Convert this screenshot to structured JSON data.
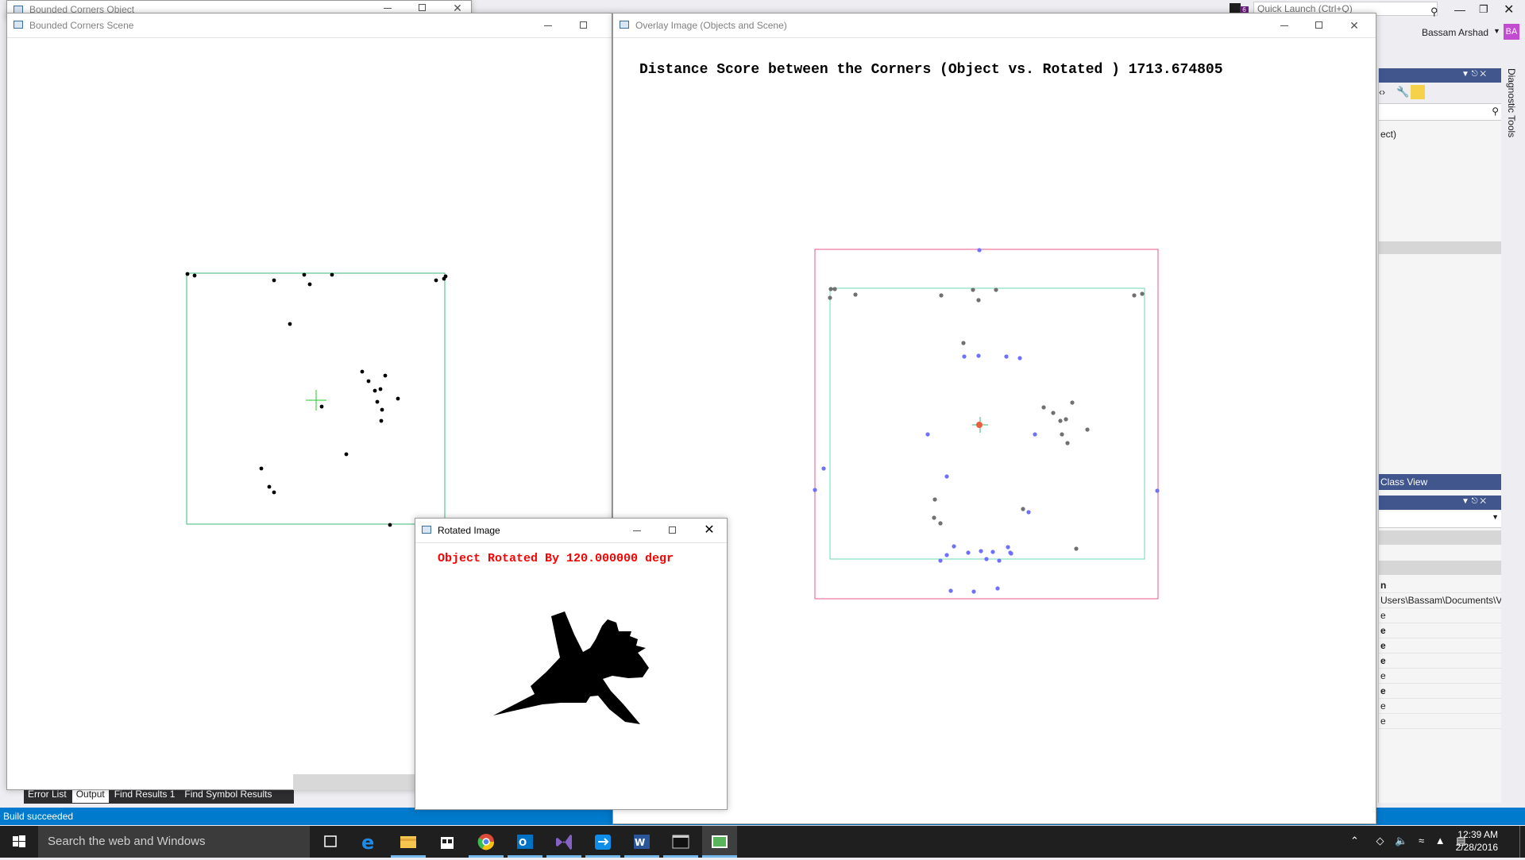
{
  "vs": {
    "quick_launch_placeholder": "Quick Launch (Ctrl+Q)",
    "user_name": "Bassam Arshad",
    "user_initials": "BA",
    "notification_count": "6",
    "diagnostic_tools_label": "Diagnostic Tools",
    "class_view_label": "Class View",
    "solution_text": "ect)",
    "path_text": "Users\\Bassam\\Documents\\V",
    "prop_rows": [
      "n",
      "e",
      "e",
      "e",
      "e",
      "e",
      "e",
      "e",
      "e"
    ],
    "bottom_tabs": [
      {
        "label": "Error List",
        "selected": false
      },
      {
        "label": "Output",
        "selected": true
      },
      {
        "label": "Find Results 1",
        "selected": false
      },
      {
        "label": "Find Symbol Results",
        "selected": false
      }
    ],
    "status_text": "Build succeeded"
  },
  "windows": {
    "object": {
      "title": "Bounded Corners Object"
    },
    "scene": {
      "title": "Bounded Corners Scene"
    },
    "overlay": {
      "title": "Overlay Image (Objects and Scene)",
      "caption": "Distance Score between the Corners (Object vs. Rotated ) 1713.674805"
    },
    "rotated": {
      "title": "Rotated Image",
      "caption": "Object Rotated By 120.000000 degr"
    }
  },
  "taskbar": {
    "search_placeholder": "Search the web and Windows",
    "time": "12:39 AM",
    "date": "2/28/2016",
    "apps": [
      "task-view",
      "edge",
      "file-explorer",
      "store",
      "chrome",
      "outlook",
      "visual-studio",
      "teamviewer",
      "word",
      "console",
      "image-viewer"
    ]
  },
  "colors": {
    "vs_blue": "#007acc",
    "bbox_green": "#3cb878",
    "bbox_pink": "#e85a8a",
    "corner_gray": "#707070",
    "corner_blue": "#7070ff",
    "caption_red": "#ff0000"
  }
}
